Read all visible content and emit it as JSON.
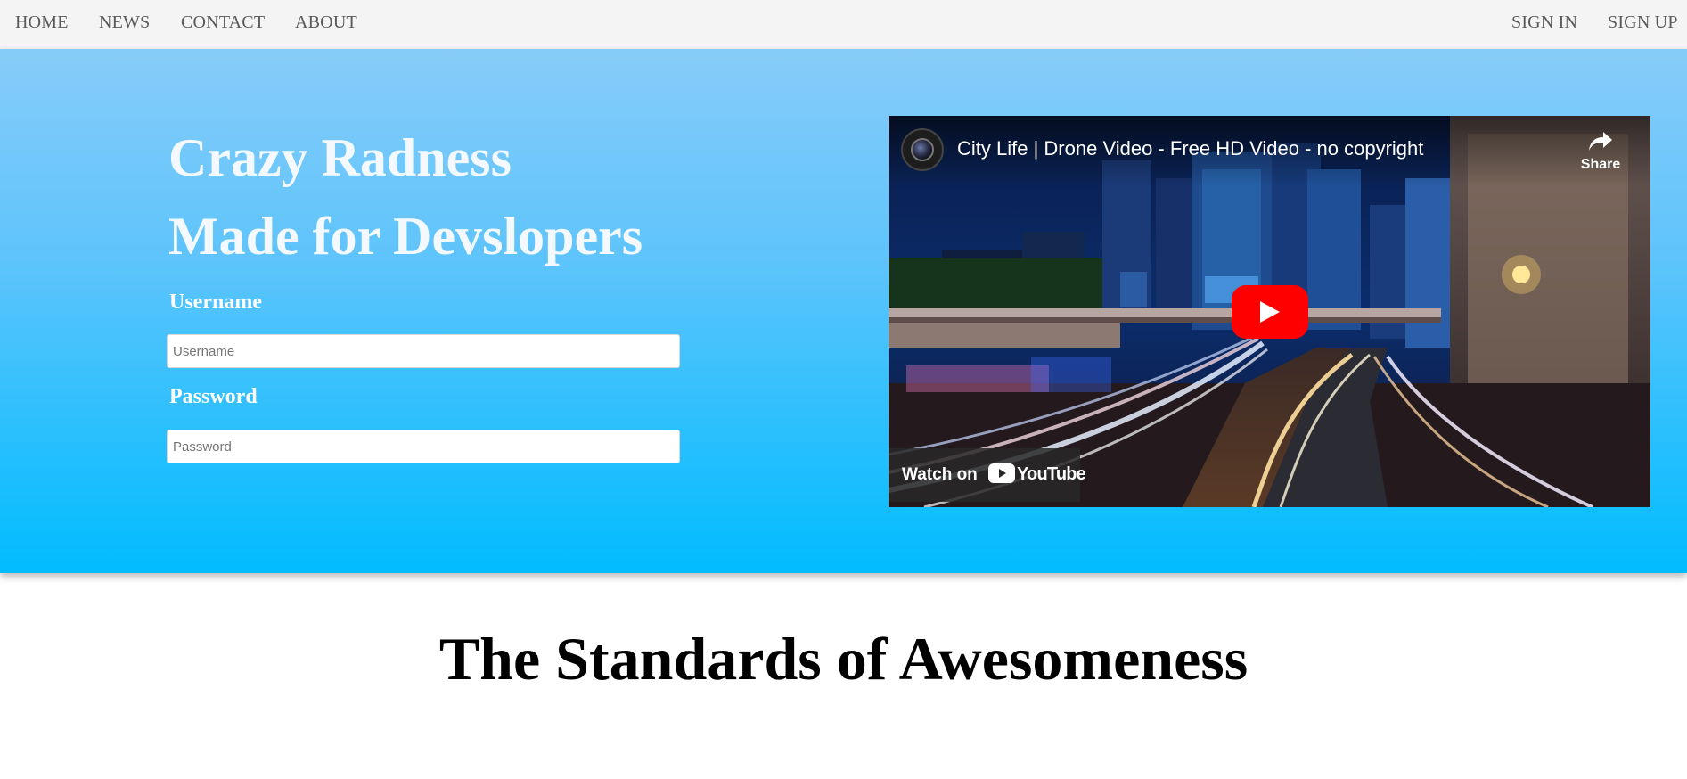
{
  "nav": {
    "left": [
      {
        "label": "HOME"
      },
      {
        "label": "NEWS"
      },
      {
        "label": "CONTACT"
      },
      {
        "label": "ABOUT"
      }
    ],
    "right": [
      {
        "label": "SIGN IN"
      },
      {
        "label": "SIGN UP"
      }
    ]
  },
  "hero": {
    "title_line1": "Crazy Radness",
    "title_line2": "Made for Devslopers",
    "username_label": "Username",
    "username_placeholder": "Username",
    "password_label": "Password",
    "password_placeholder": "Password"
  },
  "video": {
    "title": "City Life | Drone Video - Free HD Video - no copyright",
    "share_label": "Share",
    "watch_on_label": "Watch on",
    "youtube_word": "YouTube",
    "icons": [
      "channel-avatar-icon",
      "share-arrow-icon",
      "play-icon",
      "youtube-logo-icon"
    ],
    "colors": {
      "play_button": "#ff0000"
    }
  },
  "section": {
    "heading": "The Standards of Awesomeness"
  },
  "colors": {
    "nav_bg": "#f4f4f4",
    "hero_top": "#87ccf9",
    "hero_bottom": "#00bcff"
  }
}
